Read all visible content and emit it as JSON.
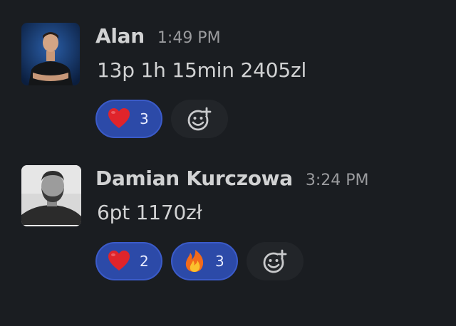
{
  "messages": [
    {
      "author": "Alan",
      "time": "1:49 PM",
      "text": "13p 1h 15min 2405zl",
      "reactions": [
        {
          "emoji": "heart-icon",
          "count": "3"
        }
      ]
    },
    {
      "author": "Damian Kurczowa",
      "time": "3:24 PM",
      "text": "6pt 1170zł",
      "reactions": [
        {
          "emoji": "heart-icon",
          "count": "2"
        },
        {
          "emoji": "fire-icon",
          "count": "3"
        }
      ]
    }
  ],
  "colors": {
    "background": "#1a1d21",
    "reaction_active": "#2c4aa8",
    "reaction_border": "#3b5bc9",
    "add_reaction_bg": "#222529"
  }
}
